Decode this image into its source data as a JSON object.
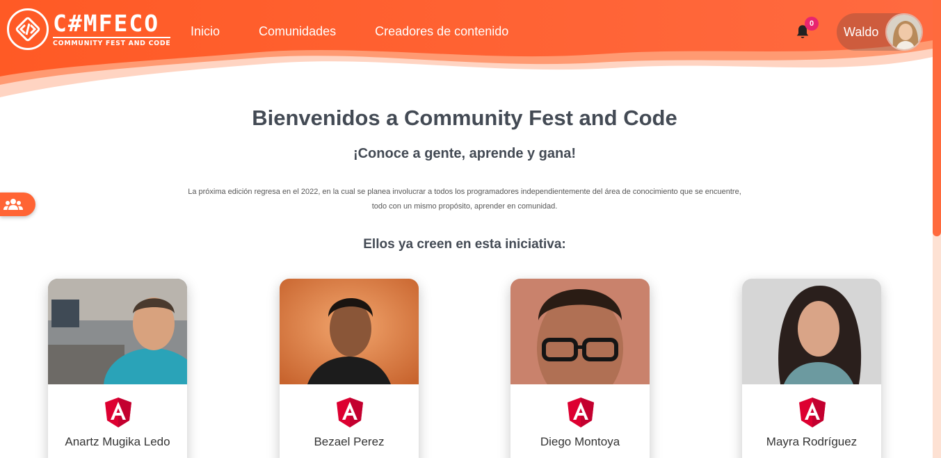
{
  "brand": {
    "logo_main": "C#MFECO",
    "logo_sub": "COMMUNITY FEST AND CODE",
    "accent": "#ff5a2c"
  },
  "nav": {
    "items": [
      {
        "label": "Inicio"
      },
      {
        "label": "Comunidades"
      },
      {
        "label": "Creadores de contenido"
      }
    ]
  },
  "notifications": {
    "count": "0",
    "icon": "bell-icon"
  },
  "user": {
    "name": "Waldo"
  },
  "side_tab": {
    "icon": "users-group-icon"
  },
  "main": {
    "title": "Bienvenidos a Community Fest and Code",
    "subtitle": "¡Conoce a gente, aprende y gana!",
    "description_line1": "La próxima edición regresa en el 2022, en la cual se planea involucrar a todos los programadores independientemente del área de conocimiento que se encuentre,",
    "description_line2": "todo con un mismo propósito, aprender en comunidad.",
    "believers_title": "Ellos ya creen en esta iniciativa:"
  },
  "creators": [
    {
      "name": "Anartz Mugika Ledo",
      "tech_icon": "angular-icon"
    },
    {
      "name": "Bezael Perez",
      "tech_icon": "angular-icon"
    },
    {
      "name": "Diego Montoya",
      "tech_icon": "angular-icon"
    },
    {
      "name": "Mayra Rodríguez",
      "tech_icon": "angular-icon"
    }
  ]
}
